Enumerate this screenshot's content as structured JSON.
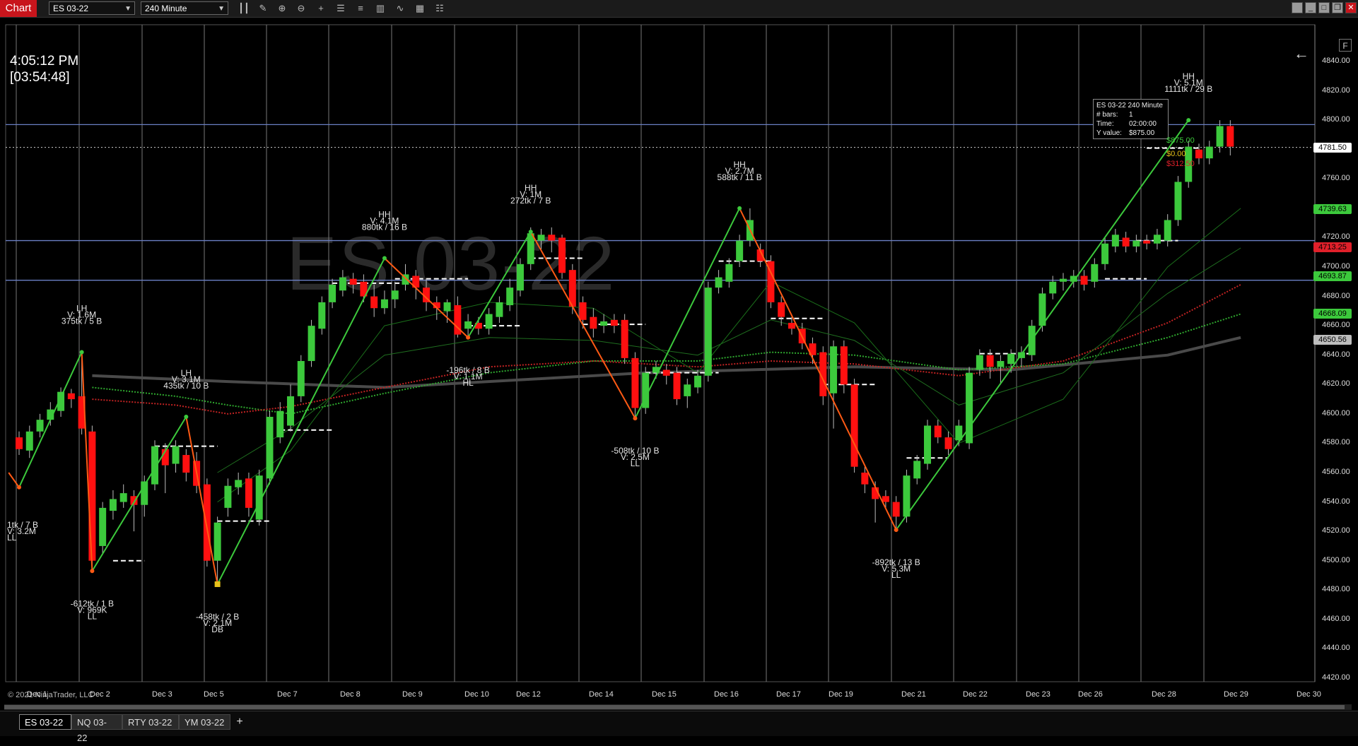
{
  "toolbar": {
    "chart_label": "Chart",
    "instrument": "ES 03-22",
    "interval": "240 Minute"
  },
  "clock": {
    "time": "4:05:12 PM",
    "countdown": "[03:54:48]"
  },
  "watermark": "ES 03-22",
  "copyright": "© 2021 NinjaTrader, LLC",
  "f_button": "F",
  "tooltip": {
    "title": "ES 03-22 240 Minute",
    "rows": [
      {
        "k": "# bars:",
        "v": "1"
      },
      {
        "k": "Time:",
        "v": "02:00:00"
      },
      {
        "k": "Y value:",
        "v": "$875.00"
      }
    ]
  },
  "tabs": [
    "ES 03-22",
    "NQ 03-22",
    "RTY 03-22",
    "YM 03-22"
  ],
  "price_tags": [
    {
      "label": "4781.50",
      "value": 4781.5,
      "color": "#ffffff"
    },
    {
      "label": "4739.63",
      "value": 4739.63,
      "color": "#3cc93c"
    },
    {
      "label": "4713.25",
      "value": 4713.25,
      "color": "#e0202a"
    },
    {
      "label": "4693.87",
      "value": 4693.87,
      "color": "#3cc93c"
    },
    {
      "label": "4668.09",
      "value": 4668.09,
      "color": "#3cc93c"
    },
    {
      "label": "4650.56",
      "value": 4650.56,
      "color": "#bdbdbd"
    }
  ],
  "trade_labels": [
    {
      "text": "$875.00",
      "color": "#3cc93c"
    },
    {
      "text": "$0.00",
      "color": "#e8c21a"
    },
    {
      "text": "$312.50",
      "color": "#e0202a"
    }
  ],
  "chart_data": {
    "type": "candlestick",
    "ylim": [
      4415,
      4850
    ],
    "y_ticks": [
      4840,
      4820,
      4800,
      4780,
      4760,
      4740,
      4720,
      4700,
      4680,
      4660,
      4640,
      4620,
      4600,
      4580,
      4560,
      4540,
      4520,
      4500,
      4480,
      4460,
      4440,
      4420
    ],
    "date_labels": [
      "Dec 1",
      "Dec 2",
      "Dec 3",
      "Dec 5",
      "Dec 7",
      "Dec 8",
      "Dec 9",
      "Dec 10",
      "Dec 12",
      "Dec 14",
      "Dec 15",
      "Dec 16",
      "Dec 17",
      "Dec 19",
      "Dec 21",
      "Dec 22",
      "Dec 23",
      "Dec 26",
      "Dec 28",
      "Dec 29",
      "Dec 30"
    ],
    "horizontal_lines": [
      4797,
      4718,
      4691
    ],
    "candles": [
      {
        "o": 4584,
        "c": 4576,
        "h": 4588,
        "l": 4572
      },
      {
        "o": 4575,
        "c": 4588,
        "h": 4592,
        "l": 4570
      },
      {
        "o": 4588,
        "c": 4596,
        "h": 4600,
        "l": 4584
      },
      {
        "o": 4596,
        "c": 4603,
        "h": 4608,
        "l": 4592
      },
      {
        "o": 4602,
        "c": 4615,
        "h": 4618,
        "l": 4598
      },
      {
        "o": 4614,
        "c": 4610,
        "h": 4617,
        "l": 4604
      },
      {
        "o": 4612,
        "c": 4590,
        "h": 4642,
        "l": 4586
      },
      {
        "o": 4588,
        "c": 4500,
        "h": 4592,
        "l": 4493
      },
      {
        "o": 4510,
        "c": 4536,
        "h": 4540,
        "l": 4505
      },
      {
        "o": 4534,
        "c": 4542,
        "h": 4548,
        "l": 4528
      },
      {
        "o": 4540,
        "c": 4546,
        "h": 4552,
        "l": 4536
      },
      {
        "o": 4544,
        "c": 4538,
        "h": 4548,
        "l": 4520
      },
      {
        "o": 4538,
        "c": 4554,
        "h": 4558,
        "l": 4530
      },
      {
        "o": 4552,
        "c": 4578,
        "h": 4582,
        "l": 4548
      },
      {
        "o": 4576,
        "c": 4565,
        "h": 4580,
        "l": 4546
      },
      {
        "o": 4566,
        "c": 4578,
        "h": 4582,
        "l": 4560
      },
      {
        "o": 4572,
        "c": 4560,
        "h": 4576,
        "l": 4554
      },
      {
        "o": 4568,
        "c": 4551,
        "h": 4574,
        "l": 4546
      },
      {
        "o": 4552,
        "c": 4500,
        "h": 4556,
        "l": 4496
      },
      {
        "o": 4500,
        "c": 4526,
        "h": 4530,
        "l": 4484
      },
      {
        "o": 4536,
        "c": 4551,
        "h": 4556,
        "l": 4530
      },
      {
        "o": 4550,
        "c": 4555,
        "h": 4560,
        "l": 4545
      },
      {
        "o": 4556,
        "c": 4536,
        "h": 4560,
        "l": 4530
      },
      {
        "o": 4528,
        "c": 4558,
        "h": 4562,
        "l": 4524
      },
      {
        "o": 4556,
        "c": 4598,
        "h": 4602,
        "l": 4552
      },
      {
        "o": 4584,
        "c": 4602,
        "h": 4608,
        "l": 4580
      },
      {
        "o": 4592,
        "c": 4612,
        "h": 4620,
        "l": 4588
      },
      {
        "o": 4612,
        "c": 4636,
        "h": 4640,
        "l": 4608
      },
      {
        "o": 4636,
        "c": 4660,
        "h": 4664,
        "l": 4632
      },
      {
        "o": 4658,
        "c": 4676,
        "h": 4680,
        "l": 4654
      },
      {
        "o": 4676,
        "c": 4688,
        "h": 4692,
        "l": 4672
      },
      {
        "o": 4684,
        "c": 4693,
        "h": 4698,
        "l": 4680
      },
      {
        "o": 4692,
        "c": 4688,
        "h": 4696,
        "l": 4682
      },
      {
        "o": 4690,
        "c": 4680,
        "h": 4695,
        "l": 4676
      },
      {
        "o": 4680,
        "c": 4672,
        "h": 4688,
        "l": 4666
      },
      {
        "o": 4672,
        "c": 4678,
        "h": 4684,
        "l": 4668
      },
      {
        "o": 4678,
        "c": 4684,
        "h": 4690,
        "l": 4672
      },
      {
        "o": 4688,
        "c": 4695,
        "h": 4702,
        "l": 4684
      },
      {
        "o": 4694,
        "c": 4686,
        "h": 4698,
        "l": 4678
      },
      {
        "o": 4686,
        "c": 4676,
        "h": 4692,
        "l": 4670
      },
      {
        "o": 4676,
        "c": 4672,
        "h": 4680,
        "l": 4664
      },
      {
        "o": 4670,
        "c": 4676,
        "h": 4678,
        "l": 4662
      },
      {
        "o": 4674,
        "c": 4654,
        "h": 4680,
        "l": 4652
      },
      {
        "o": 4658,
        "c": 4663,
        "h": 4668,
        "l": 4652
      },
      {
        "o": 4662,
        "c": 4658,
        "h": 4666,
        "l": 4654
      },
      {
        "o": 4658,
        "c": 4668,
        "h": 4672,
        "l": 4654
      },
      {
        "o": 4666,
        "c": 4676,
        "h": 4680,
        "l": 4662
      },
      {
        "o": 4674,
        "c": 4686,
        "h": 4692,
        "l": 4670
      },
      {
        "o": 4684,
        "c": 4702,
        "h": 4706,
        "l": 4680
      },
      {
        "o": 4702,
        "c": 4723,
        "h": 4727,
        "l": 4698
      },
      {
        "o": 4718,
        "c": 4722,
        "h": 4726,
        "l": 4712
      },
      {
        "o": 4722,
        "c": 4718,
        "h": 4727,
        "l": 4710
      },
      {
        "o": 4720,
        "c": 4696,
        "h": 4722,
        "l": 4692
      },
      {
        "o": 4698,
        "c": 4673,
        "h": 4702,
        "l": 4668
      },
      {
        "o": 4676,
        "c": 4664,
        "h": 4680,
        "l": 4658
      },
      {
        "o": 4666,
        "c": 4658,
        "h": 4672,
        "l": 4652
      },
      {
        "o": 4660,
        "c": 4663,
        "h": 4668,
        "l": 4655
      },
      {
        "o": 4664,
        "c": 4660,
        "h": 4668,
        "l": 4655
      },
      {
        "o": 4664,
        "c": 4638,
        "h": 4668,
        "l": 4634
      },
      {
        "o": 4638,
        "c": 4604,
        "h": 4642,
        "l": 4597
      },
      {
        "o": 4604,
        "c": 4628,
        "h": 4632,
        "l": 4600
      },
      {
        "o": 4628,
        "c": 4632,
        "h": 4636,
        "l": 4624
      },
      {
        "o": 4630,
        "c": 4626,
        "h": 4634,
        "l": 4620
      },
      {
        "o": 4628,
        "c": 4610,
        "h": 4632,
        "l": 4606
      },
      {
        "o": 4612,
        "c": 4620,
        "h": 4624,
        "l": 4604
      },
      {
        "o": 4618,
        "c": 4626,
        "h": 4630,
        "l": 4614
      },
      {
        "o": 4626,
        "c": 4686,
        "h": 4690,
        "l": 4622
      },
      {
        "o": 4686,
        "c": 4693,
        "h": 4698,
        "l": 4682
      },
      {
        "o": 4690,
        "c": 4702,
        "h": 4706,
        "l": 4686
      },
      {
        "o": 4704,
        "c": 4718,
        "h": 4722,
        "l": 4700
      },
      {
        "o": 4718,
        "c": 4732,
        "h": 4740,
        "l": 4714
      },
      {
        "o": 4712,
        "c": 4704,
        "h": 4716,
        "l": 4700
      },
      {
        "o": 4704,
        "c": 4676,
        "h": 4708,
        "l": 4672
      },
      {
        "o": 4676,
        "c": 4666,
        "h": 4680,
        "l": 4660
      },
      {
        "o": 4662,
        "c": 4658,
        "h": 4666,
        "l": 4654
      },
      {
        "o": 4658,
        "c": 4648,
        "h": 4662,
        "l": 4644
      },
      {
        "o": 4648,
        "c": 4640,
        "h": 4652,
        "l": 4634
      },
      {
        "o": 4642,
        "c": 4612,
        "h": 4646,
        "l": 4606
      },
      {
        "o": 4614,
        "c": 4646,
        "h": 4650,
        "l": 4590
      },
      {
        "o": 4646,
        "c": 4620,
        "h": 4650,
        "l": 4614
      },
      {
        "o": 4620,
        "c": 4564,
        "h": 4624,
        "l": 4560
      },
      {
        "o": 4560,
        "c": 4552,
        "h": 4564,
        "l": 4546
      },
      {
        "o": 4550,
        "c": 4542,
        "h": 4554,
        "l": 4526
      },
      {
        "o": 4544,
        "c": 4540,
        "h": 4548,
        "l": 4536
      },
      {
        "o": 4540,
        "c": 4530,
        "h": 4544,
        "l": 4521
      },
      {
        "o": 4530,
        "c": 4558,
        "h": 4562,
        "l": 4526
      },
      {
        "o": 4556,
        "c": 4568,
        "h": 4572,
        "l": 4552
      },
      {
        "o": 4566,
        "c": 4592,
        "h": 4596,
        "l": 4562
      },
      {
        "o": 4592,
        "c": 4584,
        "h": 4596,
        "l": 4580
      },
      {
        "o": 4584,
        "c": 4576,
        "h": 4588,
        "l": 4572
      },
      {
        "o": 4582,
        "c": 4592,
        "h": 4596,
        "l": 4578
      },
      {
        "o": 4580,
        "c": 4628,
        "h": 4632,
        "l": 4576
      },
      {
        "o": 4630,
        "c": 4640,
        "h": 4644,
        "l": 4626
      },
      {
        "o": 4640,
        "c": 4632,
        "h": 4644,
        "l": 4624
      },
      {
        "o": 4632,
        "c": 4636,
        "h": 4640,
        "l": 4620
      },
      {
        "o": 4634,
        "c": 4641,
        "h": 4644,
        "l": 4628
      },
      {
        "o": 4638,
        "c": 4642,
        "h": 4646,
        "l": 4632
      },
      {
        "o": 4640,
        "c": 4660,
        "h": 4664,
        "l": 4636
      },
      {
        "o": 4660,
        "c": 4682,
        "h": 4686,
        "l": 4656
      },
      {
        "o": 4682,
        "c": 4690,
        "h": 4694,
        "l": 4678
      },
      {
        "o": 4690,
        "c": 4692,
        "h": 4696,
        "l": 4684
      },
      {
        "o": 4690,
        "c": 4694,
        "h": 4698,
        "l": 4686
      },
      {
        "o": 4694,
        "c": 4688,
        "h": 4698,
        "l": 4684
      },
      {
        "o": 4690,
        "c": 4702,
        "h": 4706,
        "l": 4686
      },
      {
        "o": 4702,
        "c": 4716,
        "h": 4720,
        "l": 4698
      },
      {
        "o": 4714,
        "c": 4722,
        "h": 4726,
        "l": 4710
      },
      {
        "o": 4720,
        "c": 4714,
        "h": 4724,
        "l": 4710
      },
      {
        "o": 4714,
        "c": 4718,
        "h": 4722,
        "l": 4710
      },
      {
        "o": 4718,
        "c": 4716,
        "h": 4722,
        "l": 4712
      },
      {
        "o": 4716,
        "c": 4722,
        "h": 4726,
        "l": 4712
      },
      {
        "o": 4718,
        "c": 4732,
        "h": 4736,
        "l": 4714
      },
      {
        "o": 4732,
        "c": 4758,
        "h": 4762,
        "l": 4728
      },
      {
        "o": 4758,
        "c": 4782,
        "h": 4786,
        "l": 4754
      },
      {
        "o": 4780,
        "c": 4774,
        "h": 4784,
        "l": 4770
      },
      {
        "o": 4774,
        "c": 4782,
        "h": 4786,
        "l": 4770
      },
      {
        "o": 4782,
        "c": 4796,
        "h": 4800,
        "l": 4778
      },
      {
        "o": 4796,
        "c": 4782,
        "h": 4800,
        "l": 4776
      }
    ],
    "zigzag": [
      {
        "i": -1,
        "v": 4560
      },
      {
        "i": 0,
        "v": 4550
      },
      {
        "i": 6,
        "v": 4642
      },
      {
        "i": 7,
        "v": 4493
      },
      {
        "i": 16,
        "v": 4598
      },
      {
        "i": 19,
        "v": 4484
      },
      {
        "i": 35,
        "v": 4706
      },
      {
        "i": 43,
        "v": 4652
      },
      {
        "i": 49,
        "v": 4724
      },
      {
        "i": 59,
        "v": 4597
      },
      {
        "i": 69,
        "v": 4740
      },
      {
        "i": 84,
        "v": 4521
      },
      {
        "i": 112,
        "v": 4800
      }
    ],
    "swing_labels": [
      {
        "i": 6,
        "v": 4642,
        "pos": "above",
        "lines": [
          "LH",
          "V: 1.6M",
          "375tk / 5 B"
        ]
      },
      {
        "i": 7,
        "v": 4493,
        "pos": "below",
        "lines": [
          "-612tk / 1 B",
          "V: 969K",
          "LL"
        ]
      },
      {
        "i": 16,
        "v": 4598,
        "pos": "above",
        "lines": [
          "LH",
          "V: 3.1M",
          "435tk / 10 B"
        ]
      },
      {
        "i": 19,
        "v": 4484,
        "pos": "below",
        "lines": [
          "-458tk / 2 B",
          "V: 2.1M",
          "DB"
        ]
      },
      {
        "i": 35,
        "v": 4706,
        "pos": "above",
        "lines": [
          "HH",
          "V: 4.1M",
          "880tk / 16 B"
        ]
      },
      {
        "i": 43,
        "v": 4652,
        "pos": "below",
        "lines": [
          "-196tk / 8 B",
          "V: 1.1M",
          "HL"
        ]
      },
      {
        "i": 49,
        "v": 4724,
        "pos": "above",
        "lines": [
          "HH",
          "V: 1M",
          "272tk / 7 B"
        ]
      },
      {
        "i": 59,
        "v": 4597,
        "pos": "below",
        "lines": [
          "-508tk / 10 B",
          "V: 2.5M",
          "LL"
        ]
      },
      {
        "i": 69,
        "v": 4740,
        "pos": "above",
        "lines": [
          "HH",
          "V: 2.7M",
          "588tk / 11 B"
        ]
      },
      {
        "i": 84,
        "v": 4521,
        "pos": "below",
        "lines": [
          "-892tk / 13 B",
          "V: 5.3M",
          "LL"
        ]
      },
      {
        "i": 112,
        "v": 4800,
        "pos": "above",
        "lines": [
          "HH",
          "V: 5.1M",
          "1111tk / 29 B"
        ]
      },
      {
        "i": -1,
        "v": 4525,
        "pos": "left",
        "lines": [
          "1tk / 7 B",
          "V: 3.2M",
          "LL"
        ]
      }
    ]
  }
}
